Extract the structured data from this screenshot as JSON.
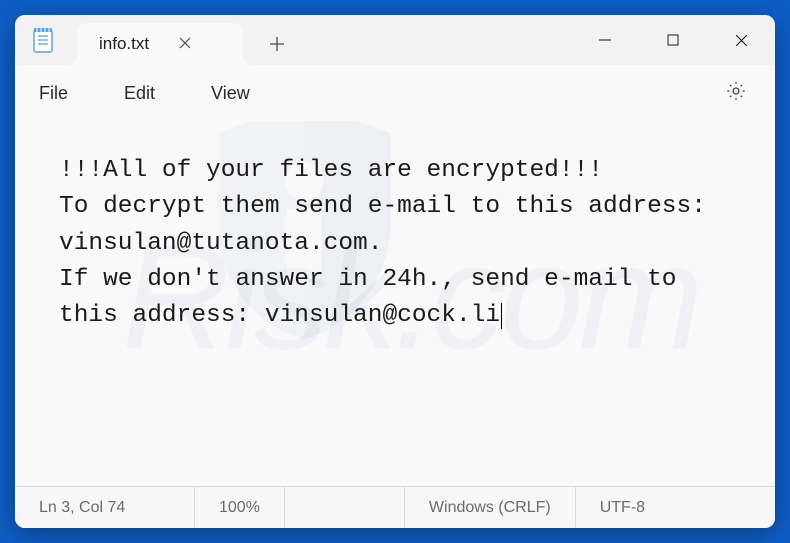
{
  "tab": {
    "title": "info.txt"
  },
  "menu": {
    "file": "File",
    "edit": "Edit",
    "view": "View"
  },
  "content": {
    "text": "!!!All of your files are encrypted!!!\nTo decrypt them send e-mail to this address: vinsulan@tutanota.com.\nIf we don't answer in 24h., send e-mail to this address: vinsulan@cock.li"
  },
  "status": {
    "position": "Ln 3, Col 74",
    "zoom": "100%",
    "line_ending": "Windows (CRLF)",
    "encoding": "UTF-8"
  }
}
